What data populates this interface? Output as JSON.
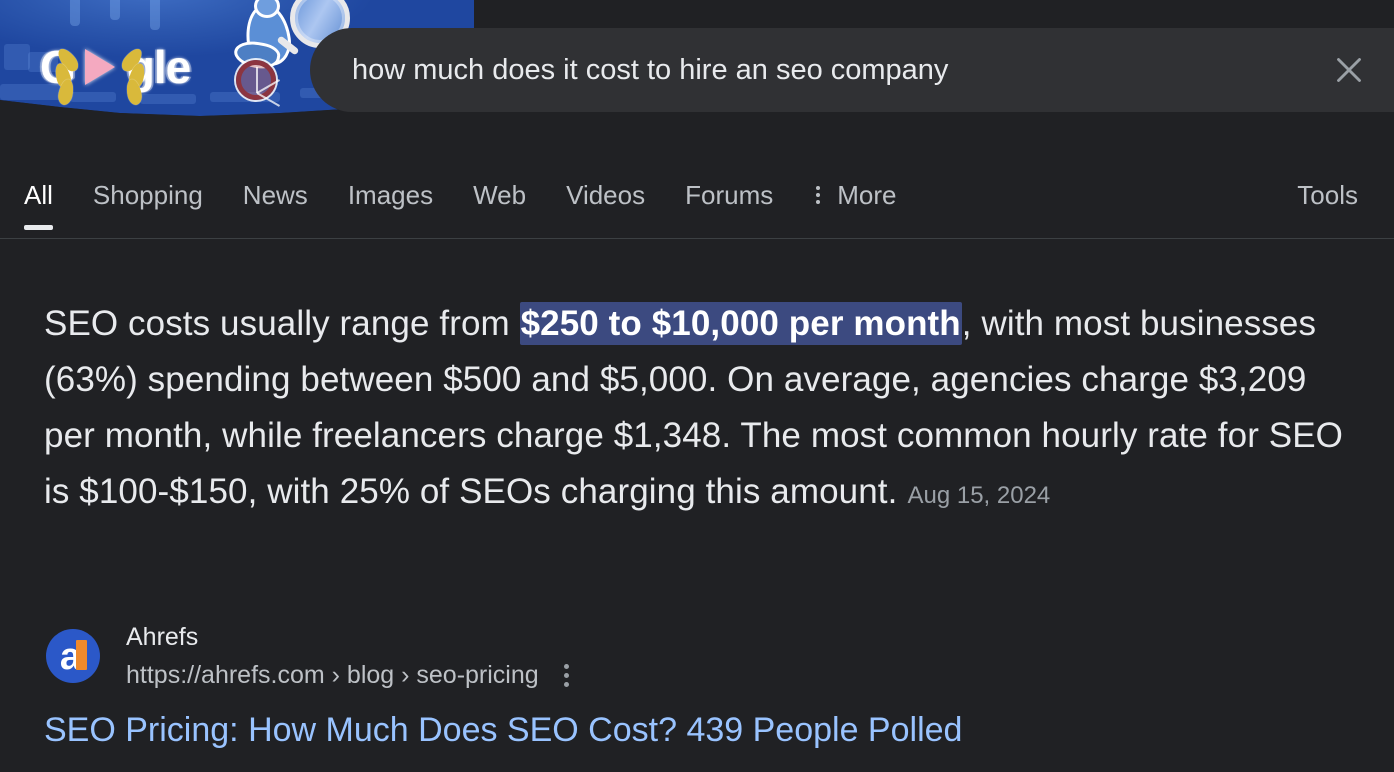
{
  "header": {
    "doodle": {
      "logo_text_before": "G",
      "logo_text_after": "gle",
      "icon_name": "google-doodle-olympics-banner"
    },
    "search": {
      "value": "how much does it cost to hire an seo company",
      "placeholder": "Search",
      "clear_icon": "close-icon"
    }
  },
  "nav": {
    "tabs": [
      {
        "label": "All",
        "active": true
      },
      {
        "label": "Shopping",
        "active": false
      },
      {
        "label": "News",
        "active": false
      },
      {
        "label": "Images",
        "active": false
      },
      {
        "label": "Web",
        "active": false
      },
      {
        "label": "Videos",
        "active": false
      },
      {
        "label": "Forums",
        "active": false
      },
      {
        "label": "More",
        "active": false,
        "icon": "more-vert-icon"
      }
    ],
    "tools_label": "Tools"
  },
  "snippet": {
    "part1": "SEO costs usually range from ",
    "highlight": "$250 to $10,000 per month",
    "part2": ", with most businesses (63%) spending between $500 and $5,000. On average, agencies charge $3,209 per month, while freelancers charge $1,348. The most common hourly rate for SEO is $100-$150, with 25% of SEOs charging this amount.",
    "date": "Aug 15, 2024",
    "highlight_color": "#3c4a80"
  },
  "result": {
    "favicon": {
      "icon_name": "ahrefs-favicon",
      "letter": "a",
      "bg_color": "#2b58c8",
      "accent_color": "#f08a2c"
    },
    "site_name": "Ahrefs",
    "url": "https://ahrefs.com › blog › seo-pricing",
    "menu_icon": "more-vert-icon",
    "title": "SEO Pricing: How Much Does SEO Cost? 439 People Polled",
    "title_color": "#99c3ff"
  }
}
